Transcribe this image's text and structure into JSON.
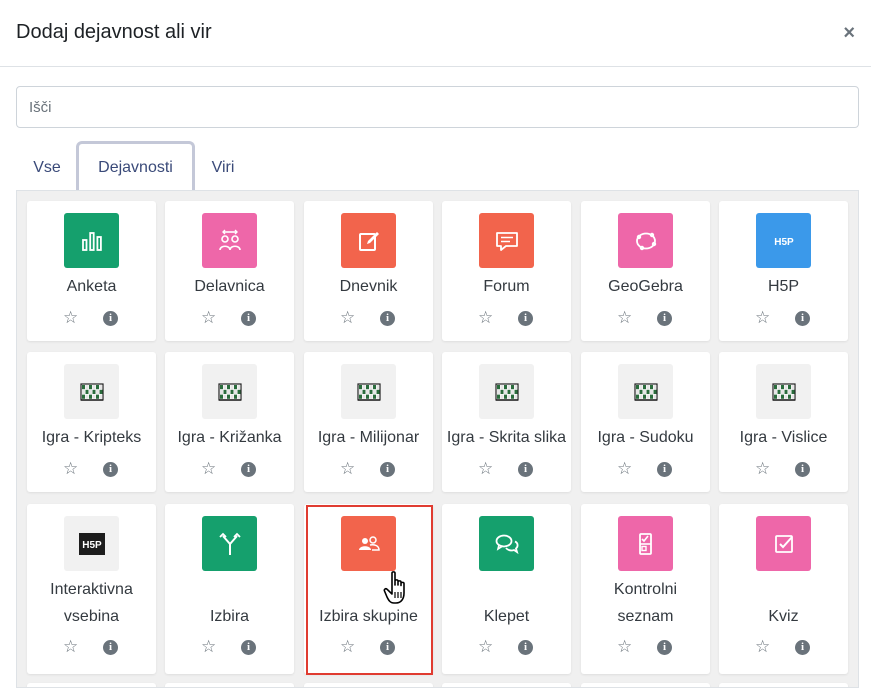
{
  "modal": {
    "title": "Dodaj dejavnost ali vir",
    "close_glyph": "×"
  },
  "search": {
    "placeholder": "Išči",
    "value": ""
  },
  "tabs": [
    {
      "label": "Vse",
      "active": false
    },
    {
      "label": "Dejavnosti",
      "active": true
    },
    {
      "label": "Viri",
      "active": false
    }
  ],
  "activities": [
    {
      "label": "Anketa",
      "label2": "",
      "color": "#15a06d",
      "icon": "bar-chart-icon"
    },
    {
      "label": "Delavnica",
      "label2": "",
      "color": "#ee67a9",
      "icon": "people-icon"
    },
    {
      "label": "Dnevnik",
      "label2": "",
      "color": "#f2644c",
      "icon": "edit-icon"
    },
    {
      "label": "Forum",
      "label2": "",
      "color": "#f2644c",
      "icon": "speech-bubble-icon"
    },
    {
      "label": "GeoGebra",
      "label2": "",
      "color": "#ee67a9",
      "icon": "geogebra-icon"
    },
    {
      "label": "H5P",
      "label2": "",
      "color": "#3b99ea",
      "icon": "h5p-icon"
    },
    {
      "label": "Igra - Kripteks",
      "label2": "",
      "color": "#f1f1f1",
      "icon": "game-grid-icon"
    },
    {
      "label": "Igra - Križanka",
      "label2": "",
      "color": "#f1f1f1",
      "icon": "game-grid-icon"
    },
    {
      "label": "Igra - Milijonar",
      "label2": "",
      "color": "#f1f1f1",
      "icon": "game-grid-icon"
    },
    {
      "label": "Igra - Skrita slika",
      "label2": "",
      "color": "#f1f1f1",
      "icon": "game-grid-icon"
    },
    {
      "label": "Igra - Sudoku",
      "label2": "",
      "color": "#f1f1f1",
      "icon": "game-grid-icon"
    },
    {
      "label": "Igra - Vislice",
      "label2": "",
      "color": "#f1f1f1",
      "icon": "game-grid-icon"
    },
    {
      "label": "Interaktivna",
      "label2": "vsebina",
      "color": "#f1f1f1",
      "icon": "h5p-dark-icon"
    },
    {
      "label": "Izbira",
      "label2": "",
      "color": "#15a06d",
      "icon": "signpost-icon"
    },
    {
      "label": "Izbira skupine",
      "label2": "",
      "color": "#f2644c",
      "icon": "group-choice-icon"
    },
    {
      "label": "Klepet",
      "label2": "",
      "color": "#15a06d",
      "icon": "chat-icon"
    },
    {
      "label": "Kontrolni",
      "label2": "seznam",
      "color": "#ee67a9",
      "icon": "checklist-icon"
    },
    {
      "label": "Kviz",
      "label2": "",
      "color": "#ee67a9",
      "icon": "quiz-checkbox-icon"
    }
  ],
  "card_actions": {
    "star_glyph": "☆",
    "info_glyph": "i"
  },
  "h5p_text": "H5P"
}
